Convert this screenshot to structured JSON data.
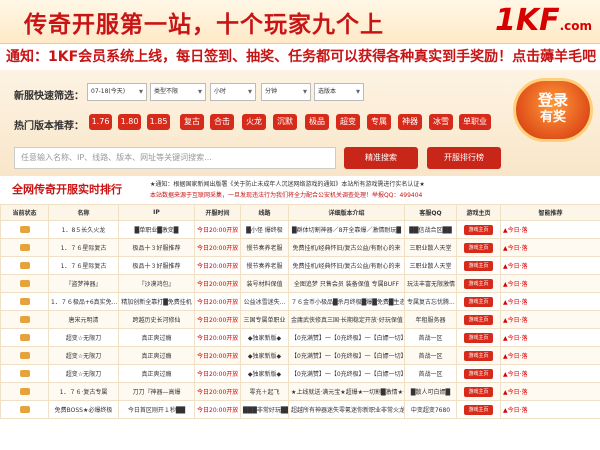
{
  "header": {
    "slogan": "传奇开服第一站，十个玩家九个上",
    "logo": "1KF",
    "logo_suffix": ".com"
  },
  "notice": "通知：1KF会员系统上线，每日签到、抽奖、任务都可以获得各种真实到手奖励！点击薅羊毛吧",
  "filter": {
    "label": "新服快速筛选：",
    "selects": [
      "07-18(今天)",
      "类型不限",
      "小时",
      "分钟",
      "选版本"
    ]
  },
  "hot": {
    "label": "热门版本推荐：",
    "tags": [
      "1.76",
      "1.80",
      "1.85",
      "复古",
      "合击",
      "火龙",
      "沉默",
      "极品",
      "超变",
      "专属",
      "神器",
      "冰雪",
      "单职业"
    ]
  },
  "search": {
    "placeholder": "任意输入名称、IP、线路、版本、网址等关键词搜索...",
    "button": "精准搜索",
    "rank_button": "开服排行榜"
  },
  "badge": {
    "line1": "登录",
    "line2": "有奖"
  },
  "section": {
    "title": "全网传奇开服实时排行",
    "notice1": "★通知：根据国家新闻出版署《关于防止未成年人沉迷网络游戏的通知》本站所有游戏需进行实名认证★",
    "notice2": "本站数据来源于互联网采集，一旦发现违法行为我们将全力配合公安机关调查处理！举报QQ：499404"
  },
  "table": {
    "headers": [
      "当前状态",
      "名称",
      "IP",
      "开服时间",
      "线路",
      "详细版本介绍",
      "客服QQ",
      "游戏主页",
      "智能推荐"
    ],
    "home_label": "游戏主页",
    "rows": [
      [
        "",
        "1．8５长久火龙",
        "█单职业█激变█",
        "今日20:00开放",
        "█小怪 爆终极",
        "█群体切割神器／8开全靠爆／激情耐玩█",
        "██信战合区██",
        "",
        "▲今日·落"
      ],
      [
        "",
        "1．７６星际复古",
        "极品十３好服推荐",
        "今日20:00开放",
        "慢节奏养老服",
        "免费挂机/经典怀旧/复古公益/有耐心的来",
        "三职业散人天堂",
        "",
        "▲今日·落"
      ],
      [
        "",
        "1．７６星际复古",
        "极品十３好服推荐",
        "今日20:00开放",
        "慢节奏养老服",
        "免费挂机/经典怀旧/复古公益/有耐心的来",
        "三职业散人天堂",
        "",
        "▲今日·落"
      ],
      [
        "",
        "『盗梦神器』",
        "『沙漠鸿包』",
        "今日20:00开放",
        "装号材料保值",
        "全图追梦 只售会员 装备保值 专属BUFF",
        "玩法丰富无限激情",
        "",
        "▲今日·落"
      ],
      [
        "",
        "1．７６极品+6真实免...",
        "精加创新全靠打█免费挂机",
        "今日20:00开放",
        "公益冰雪迷失...",
        "７６金币小极品█杀月终极█爆█免费█生态养老装备保值...",
        "专属复古忘忧腾...",
        "",
        "▲今日·落"
      ],
      [
        "",
        "唐宋元明清",
        "跨越历史长河修仙",
        "今日20:00开放",
        "三国专属单职业",
        "金庸武侠修真三国·长期稳定开放·好玩保值",
        "年租服务器",
        "",
        "▲今日·落"
      ],
      [
        "",
        "超变☆无限刀",
        "真正爽过瘾",
        "今日20:00开放",
        "◆独家新版◆",
        "【0充满赞】一【0充终极】一【白嫖一切】",
        "首战一区",
        "",
        "▲今日·落"
      ],
      [
        "",
        "超变☆无限刀",
        "真正爽过瘾",
        "今日20:00开放",
        "◆独家新版◆",
        "【0充满赞】一【0充终极】一【白嫖一切】",
        "首战一区",
        "",
        "▲今日·落"
      ],
      [
        "",
        "超变☆无限刀",
        "真正爽过瘾",
        "今日20:00开放",
        "◆独家新版◆",
        "【0充满赞】一【0充终极】一【白嫖一切】",
        "首战一区",
        "",
        "▲今日·落"
      ],
      [
        "",
        "1．７６·复古专属",
        "刀刀『神器—高爆",
        "今日20:00开放",
        "零充＋起飞",
        "★上线就送·满元宝★超爆★一切割█激情★★一",
        "█散人可白嫖█",
        "",
        "▲今日·落"
      ],
      [
        "",
        "免费BOSS★必爆终极",
        "今日首区刚开１秒██",
        "今日20:00开放",
        "███非常好玩██",
        "超越所有神器迷失零氪迷你新职业非常火龙复古",
        "中变超变7680",
        "",
        "▲今日·落"
      ]
    ]
  }
}
